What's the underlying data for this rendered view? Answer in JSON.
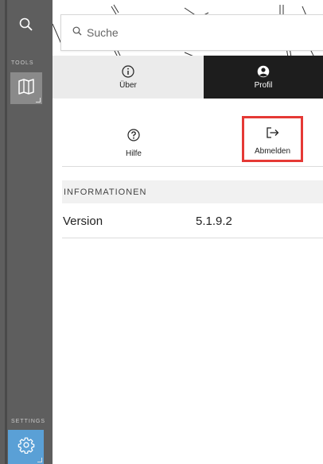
{
  "search": {
    "placeholder": "Suche"
  },
  "toolbar": {
    "tools_label": "TOOLS",
    "settings_label": "SETTINGS",
    "items": [
      {
        "id": "search",
        "icon": "search-icon"
      },
      {
        "id": "map",
        "icon": "map-icon"
      },
      {
        "id": "settings",
        "icon": "gear-icon"
      }
    ],
    "colors": {
      "background": "#5e5e5e",
      "active_map": "#8a8a8a",
      "settings_active": "#5aa0d6"
    }
  },
  "tabs": [
    {
      "label": "Über",
      "icon": "info-icon",
      "active": false
    },
    {
      "label": "Profil",
      "icon": "user-icon",
      "active": true
    }
  ],
  "actions": [
    {
      "label": "Hilfe",
      "icon": "help-icon"
    },
    {
      "label": "Abmelden",
      "icon": "logout-icon",
      "highlighted": true
    }
  ],
  "info_section": {
    "title": "INFORMATIONEN",
    "rows": [
      {
        "key": "Version",
        "value": "5.1.9.2"
      }
    ]
  },
  "colors": {
    "highlight": "#e53935",
    "active_tab_bg": "#1d1d1d",
    "inactive_tab_bg": "#ebebeb"
  }
}
